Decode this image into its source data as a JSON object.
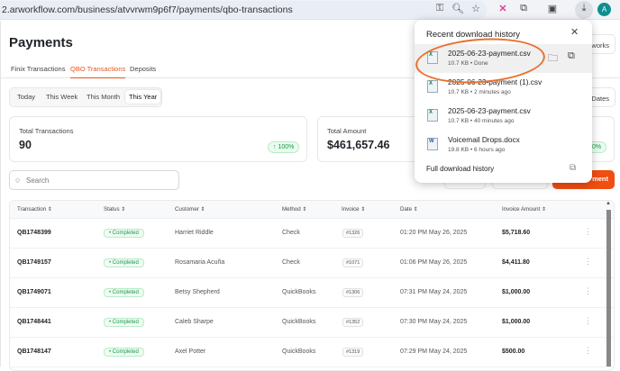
{
  "browser": {
    "url": "2.arworkflow.com/business/atvvrwm9p6f7/payments/qbo-transactions",
    "avatar": "A",
    "icons": [
      "key-icon",
      "zoom-icon",
      "star-icon",
      "extension-x-icon",
      "puzzle-icon",
      "reading-list-icon",
      "download-icon"
    ]
  },
  "page": {
    "title": "Payments",
    "tabs": [
      {
        "label": "Finix Transactions"
      },
      {
        "label": "QBO Transactions",
        "active": true
      },
      {
        "label": "Deposits"
      }
    ],
    "periods": [
      {
        "label": "Today"
      },
      {
        "label": "This Week"
      },
      {
        "label": "This Month"
      },
      {
        "label": "This Year",
        "selected": true
      }
    ],
    "partial_button_top": "works",
    "partial_button_dates": "Dates",
    "partial_button_orange": "ment",
    "cards": [
      {
        "label": "Total Transactions",
        "value": "90",
        "badge": "↑ 100%"
      },
      {
        "label": "Total Amount",
        "value": "$461,657.46",
        "badge": "0%"
      }
    ],
    "search_placeholder": "Search",
    "table": {
      "headers": [
        "Transaction",
        "Status",
        "Customer",
        "Method",
        "Invoice",
        "Date",
        "Invoice Amount"
      ],
      "rows": [
        {
          "id": "QB1748399",
          "status": "Completed",
          "customer": "Harriet Riddle",
          "method": "Check",
          "invoice": "#1326",
          "date": "01:20 PM May 26, 2025",
          "amount": "$5,718.60"
        },
        {
          "id": "QB1749157",
          "status": "Completed",
          "customer": "Rosamaria Acuña",
          "method": "Check",
          "invoice": "#1071",
          "date": "01:06 PM May 26, 2025",
          "amount": "$4,411.80"
        },
        {
          "id": "QB1749071",
          "status": "Completed",
          "customer": "Betsy Shepherd",
          "method": "QuickBooks",
          "invoice": "#1306",
          "date": "07:31 PM May 24, 2025",
          "amount": "$1,000.00"
        },
        {
          "id": "QB1748441",
          "status": "Completed",
          "customer": "Caleb Sharpe",
          "method": "QuickBooks",
          "invoice": "#1352",
          "date": "07:30 PM May 24, 2025",
          "amount": "$1,000.00"
        },
        {
          "id": "QB1748147",
          "status": "Completed",
          "customer": "Axel Potter",
          "method": "QuickBooks",
          "invoice": "#1319",
          "date": "07:29 PM May 24, 2025",
          "amount": "$500.00"
        }
      ]
    }
  },
  "downloads": {
    "title": "Recent download history",
    "full_link": "Full download history",
    "items": [
      {
        "name": "2025-06-23-payment.csv",
        "meta": "10.7 KB • Done",
        "type": "xls"
      },
      {
        "name": "2025-06-23-payment (1).csv",
        "meta": "10.7 KB • 2 minutes ago",
        "type": "xls"
      },
      {
        "name": "2025-06-23-payment.csv",
        "meta": "10.7 KB • 40 minutes ago",
        "type": "xls"
      },
      {
        "name": "Voicemail Drops.docx",
        "meta": "19.8 KB • 6 hours ago",
        "type": "doc"
      }
    ]
  },
  "colors": {
    "accent": "#e8551e",
    "orange_button": "#f04e12",
    "success": "#1a9a4a",
    "annotation": "#e8712e"
  }
}
